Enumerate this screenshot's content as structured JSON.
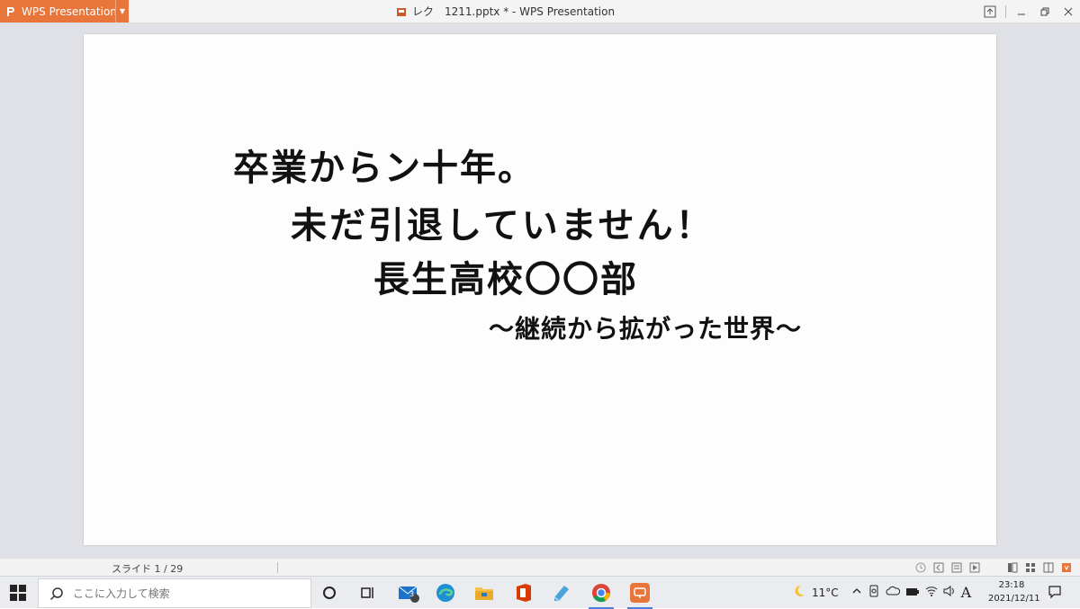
{
  "titlebar": {
    "app_label": "WPS Presentation",
    "doc_title": "レク　1211.pptx * - WPS Presentation"
  },
  "slide": {
    "line1": "卒業からン十年。",
    "line2": "未だ引退していません！",
    "line3": "長生高校〇〇部",
    "subtitle": "～継続から拡がった世界～"
  },
  "statusbar": {
    "slide_count": "スライド 1 / 29"
  },
  "taskbar": {
    "search_placeholder": "ここに入力して検索",
    "mail_badge": "3",
    "weather_temp": "11°C",
    "ime_label": "A",
    "time": "23:18",
    "date": "2021/12/11"
  },
  "colors": {
    "accent": "#e8763a",
    "workspace_bg": "#dfe1e6",
    "taskbar_bg": "#eaecef"
  }
}
